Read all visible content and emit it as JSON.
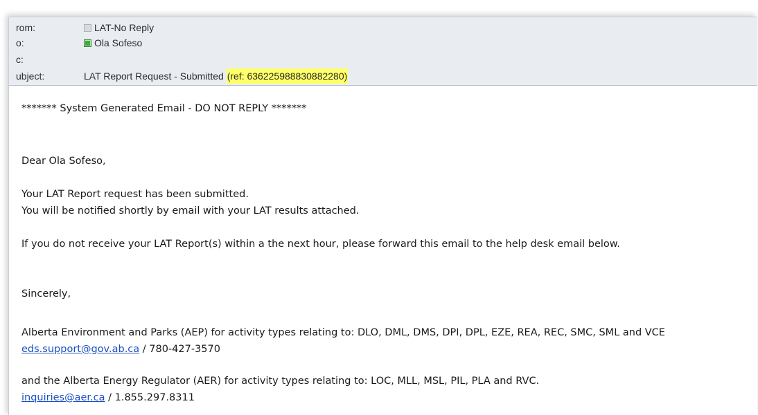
{
  "header": {
    "from_label": "rom:",
    "from_value": "LAT-No Reply",
    "to_label": "o:",
    "to_value": "Ola Sofeso",
    "cc_label": "c:",
    "subject_label": "ubject:",
    "subject_text": "LAT Report Request - Submitted ",
    "subject_ref": "(ref: 636225988830882280)"
  },
  "body": {
    "banner": "******* System Generated Email - DO NOT REPLY *******",
    "greeting": "Dear Ola Sofeso,",
    "para1_line1": "Your LAT Report request has been submitted.",
    "para1_line2": "You will be notified shortly by email with your LAT results attached.",
    "para2": "If you do not receive your LAT Report(s) within a the next hour, please forward this email to the help desk email below.",
    "closing": "Sincerely,",
    "aep_line": "Alberta Environment and Parks (AEP) for activity types relating to: DLO, DML, DMS, DPI, DPL, EZE, REA, REC, SMC, SML and VCE",
    "aep_email": "eds.support@gov.ab.ca",
    "aep_phone": " / 780-427-3570",
    "aer_line": "and the Alberta Energy Regulator (AER) for activity types relating to: LOC, MLL, MSL, PIL, PLA and RVC.",
    "aer_email": "inquiries@aer.ca",
    "aer_phone": " / 1.855.297.8311"
  },
  "colors": {
    "header_bg": "#e9edf2",
    "highlight": "#ffff66",
    "link": "#1a4fc4",
    "presence_online": "#3fa93f",
    "presence_unknown": "#d6dbe0"
  },
  "icons": {
    "from_presence": "presence-unknown-icon",
    "to_presence": "presence-online-icon"
  }
}
